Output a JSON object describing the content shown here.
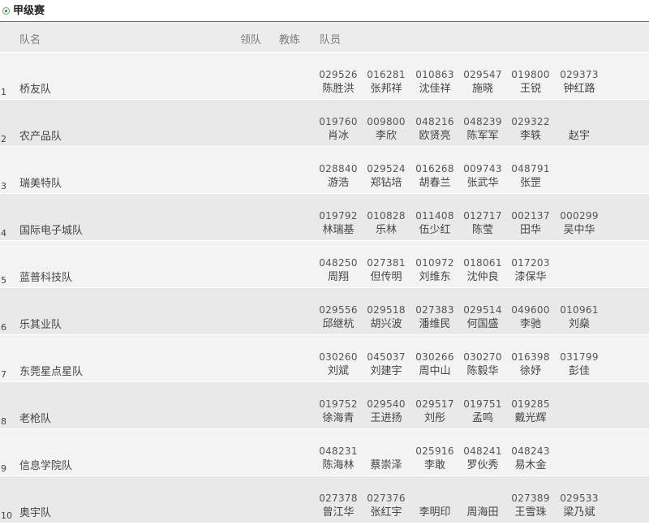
{
  "section": {
    "title": "甲级赛",
    "icon": "radio-selected-icon"
  },
  "columns": {
    "team": "队名",
    "leader": "领队",
    "coach": "教练",
    "members": "队员"
  },
  "teams": [
    {
      "num": "1",
      "name": "桥友队",
      "members": [
        {
          "id": "029526",
          "name": "陈胜洪"
        },
        {
          "id": "016281",
          "name": "张邦祥"
        },
        {
          "id": "010863",
          "name": "沈佳祥"
        },
        {
          "id": "029547",
          "name": "施晓"
        },
        {
          "id": "019800",
          "name": "王锐"
        },
        {
          "id": "029373",
          "name": "钟红路"
        }
      ]
    },
    {
      "num": "2",
      "name": "农产品队",
      "members": [
        {
          "id": "019760",
          "name": "肖冰"
        },
        {
          "id": "009800",
          "name": "李欣"
        },
        {
          "id": "048216",
          "name": "欧贤亮"
        },
        {
          "id": "048239",
          "name": "陈军军"
        },
        {
          "id": "029322",
          "name": "李轶"
        },
        {
          "id": "",
          "name": "赵宇"
        }
      ]
    },
    {
      "num": "3",
      "name": "瑞美特队",
      "members": [
        {
          "id": "028840",
          "name": "游浩"
        },
        {
          "id": "029524",
          "name": "郑钻培"
        },
        {
          "id": "016268",
          "name": "胡春兰"
        },
        {
          "id": "009743",
          "name": "张武华"
        },
        {
          "id": "048791",
          "name": "张罡"
        }
      ]
    },
    {
      "num": "4",
      "name": "国际电子城队",
      "members": [
        {
          "id": "019792",
          "name": "林瑞基"
        },
        {
          "id": "010828",
          "name": "乐林"
        },
        {
          "id": "011408",
          "name": "伍少红"
        },
        {
          "id": "012717",
          "name": "陈莹"
        },
        {
          "id": "002137",
          "name": "田华"
        },
        {
          "id": "000299",
          "name": "吴中华"
        }
      ]
    },
    {
      "num": "5",
      "name": "蓝普科技队",
      "members": [
        {
          "id": "048250",
          "name": "周翔"
        },
        {
          "id": "027381",
          "name": "但传明"
        },
        {
          "id": "010972",
          "name": "刘维东"
        },
        {
          "id": "018061",
          "name": "沈仲良"
        },
        {
          "id": "017203",
          "name": "漆保华"
        }
      ]
    },
    {
      "num": "6",
      "name": "乐其业队",
      "members": [
        {
          "id": "029556",
          "name": "邱继杭"
        },
        {
          "id": "029518",
          "name": "胡兴波"
        },
        {
          "id": "027383",
          "name": "潘维民"
        },
        {
          "id": "029514",
          "name": "何国盛"
        },
        {
          "id": "049600",
          "name": "李驰"
        },
        {
          "id": "010961",
          "name": "刘燊"
        }
      ]
    },
    {
      "num": "7",
      "name": "东莞星点星队",
      "members": [
        {
          "id": "030260",
          "name": "刘斌"
        },
        {
          "id": "045037",
          "name": "刘建宇"
        },
        {
          "id": "030266",
          "name": "周中山"
        },
        {
          "id": "030270",
          "name": "陈毅华"
        },
        {
          "id": "016398",
          "name": "徐妤"
        },
        {
          "id": "031799",
          "name": "彭佳"
        }
      ]
    },
    {
      "num": "8",
      "name": "老枪队",
      "members": [
        {
          "id": "019752",
          "name": "徐海青"
        },
        {
          "id": "029540",
          "name": "王进扬"
        },
        {
          "id": "029517",
          "name": "刘彤"
        },
        {
          "id": "019751",
          "name": "孟鸣"
        },
        {
          "id": "019285",
          "name": "戴光辉"
        }
      ]
    },
    {
      "num": "9",
      "name": "信息学院队",
      "members": [
        {
          "id": "048231",
          "name": "陈海林"
        },
        {
          "id": "",
          "name": "蔡崇泽"
        },
        {
          "id": "025916",
          "name": "李敢"
        },
        {
          "id": "048241",
          "name": "罗伙秀"
        },
        {
          "id": "048243",
          "name": "易木金"
        }
      ]
    },
    {
      "num": "10",
      "name": "奥宇队",
      "members": [
        {
          "id": "027378",
          "name": "曾江华"
        },
        {
          "id": "027376",
          "name": "张红宇"
        },
        {
          "id": "",
          "name": "李明印"
        },
        {
          "id": "",
          "name": "周海田"
        },
        {
          "id": "027389",
          "name": "王雪珠"
        },
        {
          "id": "029533",
          "name": "梁乃斌"
        }
      ]
    }
  ]
}
